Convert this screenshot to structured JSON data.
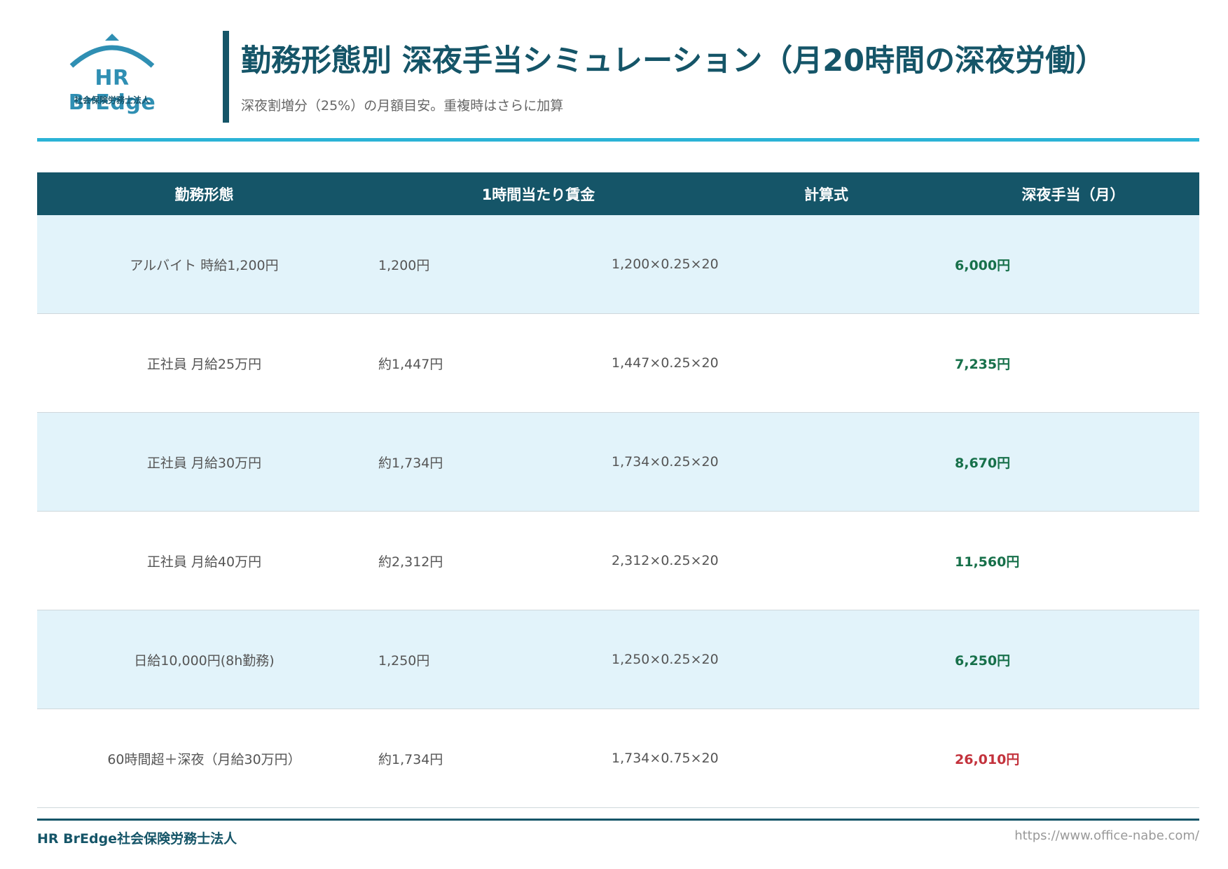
{
  "logo": {
    "name": "HR BrEdge",
    "subtitle": "社会保険労務士法人"
  },
  "header": {
    "title": "勤務形態別 深夜手当シミュレーション（月20時間の深夜労働）",
    "subtitle": "深夜割増分（25%）の月額目安。重複時はさらに加算"
  },
  "table": {
    "headers": [
      "勤務形態",
      "1時間当たり賃金",
      "計算式",
      "深夜手当（月）"
    ],
    "rows": [
      {
        "type": "アルバイト 時給1,200円",
        "hourly": "1,200円",
        "formula": "1,200×0.25×20",
        "amount": "6,000円",
        "highlight": false
      },
      {
        "type": "正社員 月給25万円",
        "hourly": "約1,447円",
        "formula": "1,447×0.25×20",
        "amount": "7,235円",
        "highlight": false
      },
      {
        "type": "正社員 月給30万円",
        "hourly": "約1,734円",
        "formula": "1,734×0.25×20",
        "amount": "8,670円",
        "highlight": false
      },
      {
        "type": "正社員 月給40万円",
        "hourly": "約2,312円",
        "formula": "2,312×0.25×20",
        "amount": "11,560円",
        "highlight": false
      },
      {
        "type": "日給10,000円(8h勤務)",
        "hourly": "1,250円",
        "formula": "1,250×0.25×20",
        "amount": "6,250円",
        "highlight": false
      },
      {
        "type": "60時間超＋深夜（月給30万円）",
        "hourly": "約1,734円",
        "formula": "1,734×0.75×20",
        "amount": "26,010円",
        "highlight": true
      }
    ]
  },
  "footer": {
    "company": "HR BrEdge社会保険労務士法人",
    "url": "https://www.office-nabe.com/"
  },
  "colors": {
    "primary": "#155568",
    "accent": "#2bb3d6",
    "amount": "#17704a",
    "amount_highlight": "#c3323c",
    "row_alt": "#e2f3fa"
  }
}
